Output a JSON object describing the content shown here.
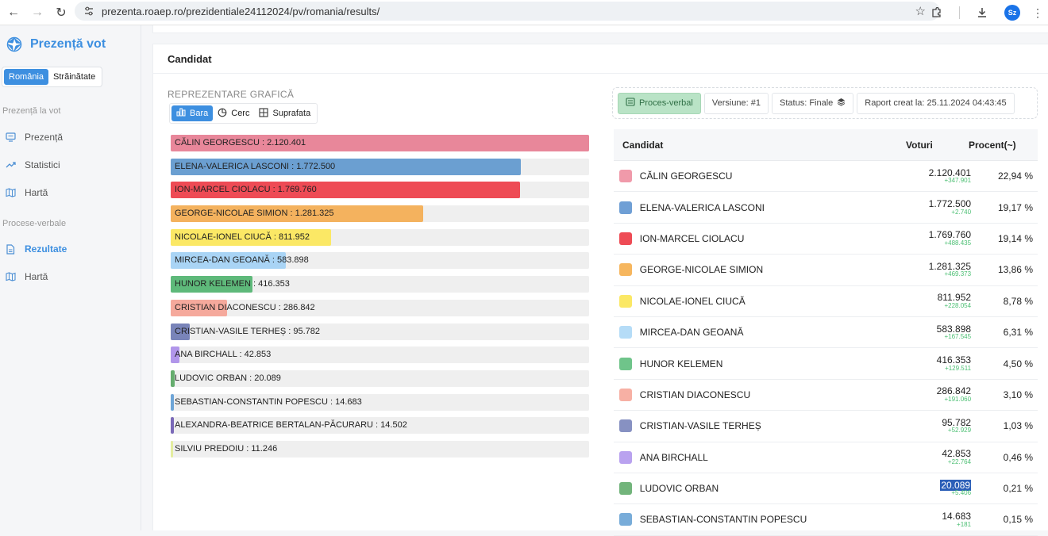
{
  "browser": {
    "url": "prezenta.roaep.ro/prezidentiale24112024/pv/romania/results/",
    "avatar": "Sz"
  },
  "sidebar": {
    "brand": "Prezență vot",
    "toggle": [
      "România",
      "Străinătate"
    ],
    "section1": "Prezență la vot",
    "items1": [
      "Prezență",
      "Statistici",
      "Hartă"
    ],
    "section2": "Procese-verbale",
    "items2": [
      "Rezultate",
      "Hartă"
    ]
  },
  "main": {
    "card_title": "Candidat",
    "rep_label": "REPREZENTARE GRAFICĂ",
    "chart_tabs": [
      "Bara",
      "Cerc",
      "Suprafata"
    ],
    "meta": {
      "pv": "Proces-verbal",
      "version": "Versiune: #1",
      "status": "Status: Finale",
      "report": "Raport creat la: 25.11.2024 04:43:45"
    },
    "table_headers": [
      "Candidat",
      "Voturi",
      "Procent(~)"
    ]
  },
  "chart_data": {
    "type": "bar",
    "categories": [
      "CĂLIN GEORGESCU",
      "ELENA-VALERICA LASCONI",
      "ION-MARCEL CIOLACU",
      "GEORGE-NICOLAE SIMION",
      "NICOLAE-IONEL CIUCĂ",
      "MIRCEA-DAN GEOANĂ",
      "HUNOR KELEMEN",
      "CRISTIAN DIACONESCU",
      "CRISTIAN-VASILE TERHEȘ",
      "ANA BIRCHALL",
      "LUDOVIC ORBAN",
      "SEBASTIAN-CONSTANTIN POPESCU",
      "ALEXANDRA-BEATRICE BERTALAN-PĂCURARU",
      "SILVIU PREDOIU"
    ],
    "values": [
      2120401,
      1772500,
      1769760,
      1281325,
      811952,
      583898,
      416353,
      286842,
      95782,
      42853,
      20089,
      14683,
      14502,
      11246
    ],
    "labels": [
      "2.120.401",
      "1.772.500",
      "1.769.760",
      "1.281.325",
      "811.952",
      "583.898",
      "416.353",
      "286.842",
      "95.782",
      "42.853",
      "20.089",
      "14.683",
      "14.502",
      "11.246"
    ],
    "colors": [
      "#e8879a",
      "#6b9fd1",
      "#ee4b55",
      "#f4b25e",
      "#fbe865",
      "#a9d4f5",
      "#5eb97a",
      "#f5a99c",
      "#7984b9",
      "#b196ea",
      "#65ad6e",
      "#6ea5d7",
      "#7b6ab8",
      "#e4ed9f"
    ]
  },
  "table": [
    {
      "name": "CĂLIN GEORGESCU",
      "votes": "2.120.401",
      "delta": "+347.901",
      "pct": "22,94 %",
      "color": "#f09aaa"
    },
    {
      "name": "ELENA-VALERICA LASCONI",
      "votes": "1.772.500",
      "delta": "+2.740",
      "pct": "19,17 %",
      "color": "#6f9fd5"
    },
    {
      "name": "ION-MARCEL CIOLACU",
      "votes": "1.769.760",
      "delta": "+488.435",
      "pct": "19,14 %",
      "color": "#ee4b55"
    },
    {
      "name": "GEORGE-NICOLAE SIMION",
      "votes": "1.281.325",
      "delta": "+469.373",
      "pct": "13,86 %",
      "color": "#f6b65e"
    },
    {
      "name": "NICOLAE-IONEL CIUCĂ",
      "votes": "811.952",
      "delta": "+228.054",
      "pct": "8,78 %",
      "color": "#fbe865"
    },
    {
      "name": "MIRCEA-DAN GEOANĂ",
      "votes": "583.898",
      "delta": "+167.545",
      "pct": "6,31 %",
      "color": "#b5dcf7"
    },
    {
      "name": "HUNOR KELEMEN",
      "votes": "416.353",
      "delta": "+129.511",
      "pct": "4,50 %",
      "color": "#6fc48a"
    },
    {
      "name": "CRISTIAN DIACONESCU",
      "votes": "286.842",
      "delta": "+191.060",
      "pct": "3,10 %",
      "color": "#f7b0a4"
    },
    {
      "name": "CRISTIAN-VASILE TERHEȘ",
      "votes": "95.782",
      "delta": "+52.929",
      "pct": "1,03 %",
      "color": "#8791c2"
    },
    {
      "name": "ANA BIRCHALL",
      "votes": "42.853",
      "delta": "+22.764",
      "pct": "0,46 %",
      "color": "#b9a2ef"
    },
    {
      "name": "LUDOVIC ORBAN",
      "votes": "20.089",
      "delta": "+5.406",
      "pct": "0,21 %",
      "color": "#72b47b",
      "selected": true
    },
    {
      "name": "SEBASTIAN-CONSTANTIN POPESCU",
      "votes": "14.683",
      "delta": "+181",
      "pct": "0,15 %",
      "color": "#78acd9"
    }
  ]
}
